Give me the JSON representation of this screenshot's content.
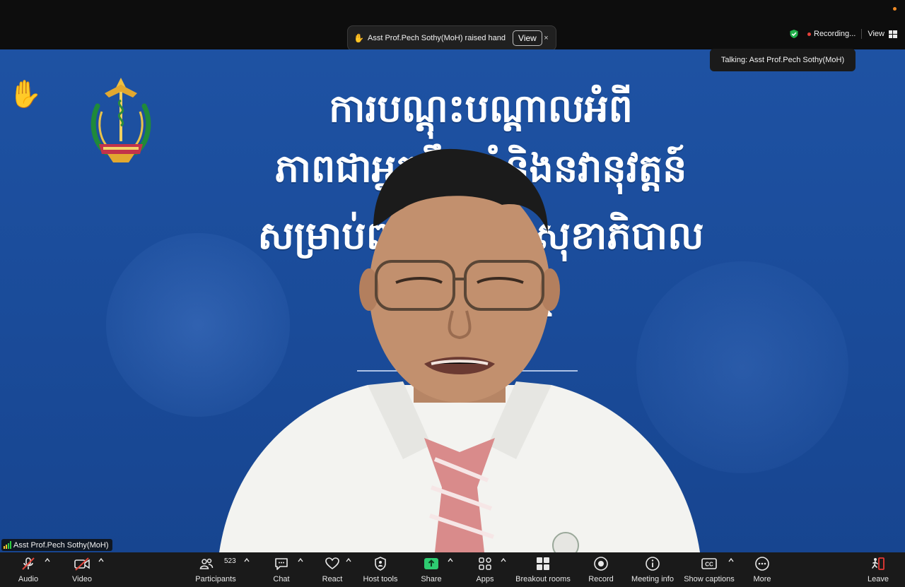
{
  "notification": {
    "message": "Asst Prof.Pech Sothy(MoH) raised hand",
    "view_label": "View",
    "close_symbol": "×"
  },
  "recording": {
    "label": "Recording...",
    "view_label": "View"
  },
  "talking": {
    "text": "Talking: Asst Prof.Pech Sothy(MoH)"
  },
  "slide": {
    "line1": "ការបណ្តុះបណ្តាលអំពី",
    "line2": "ភាពជាអ្នកដឹកនាំនិងនវានុវត្តន៍",
    "line3": "សម្រាប់ពង្រឹងប្រព័ន្ធសុខាភិបាល",
    "line4": "ឆ្នាំ២០២៥"
  },
  "participant": {
    "name": "Asst Prof.Pech Sothy(MoH)"
  },
  "toolbar": {
    "audio": "Audio",
    "video": "Video",
    "participants": "Participants",
    "participants_count": "523",
    "chat": "Chat",
    "react": "React",
    "host_tools": "Host tools",
    "share": "Share",
    "apps": "Apps",
    "breakout_rooms": "Breakout rooms",
    "record": "Record",
    "meeting_info": "Meeting info",
    "show_captions": "Show captions",
    "more": "More",
    "leave": "Leave"
  },
  "colors": {
    "slide_blue": "#1e52a3",
    "toolbar_bg": "#1a1a1a",
    "share_green": "#2ecc71",
    "leave_red": "#e53935",
    "muted_red": "#e0473d"
  },
  "icons": {
    "raise_hand": "✋",
    "notification_hand": "✋"
  }
}
